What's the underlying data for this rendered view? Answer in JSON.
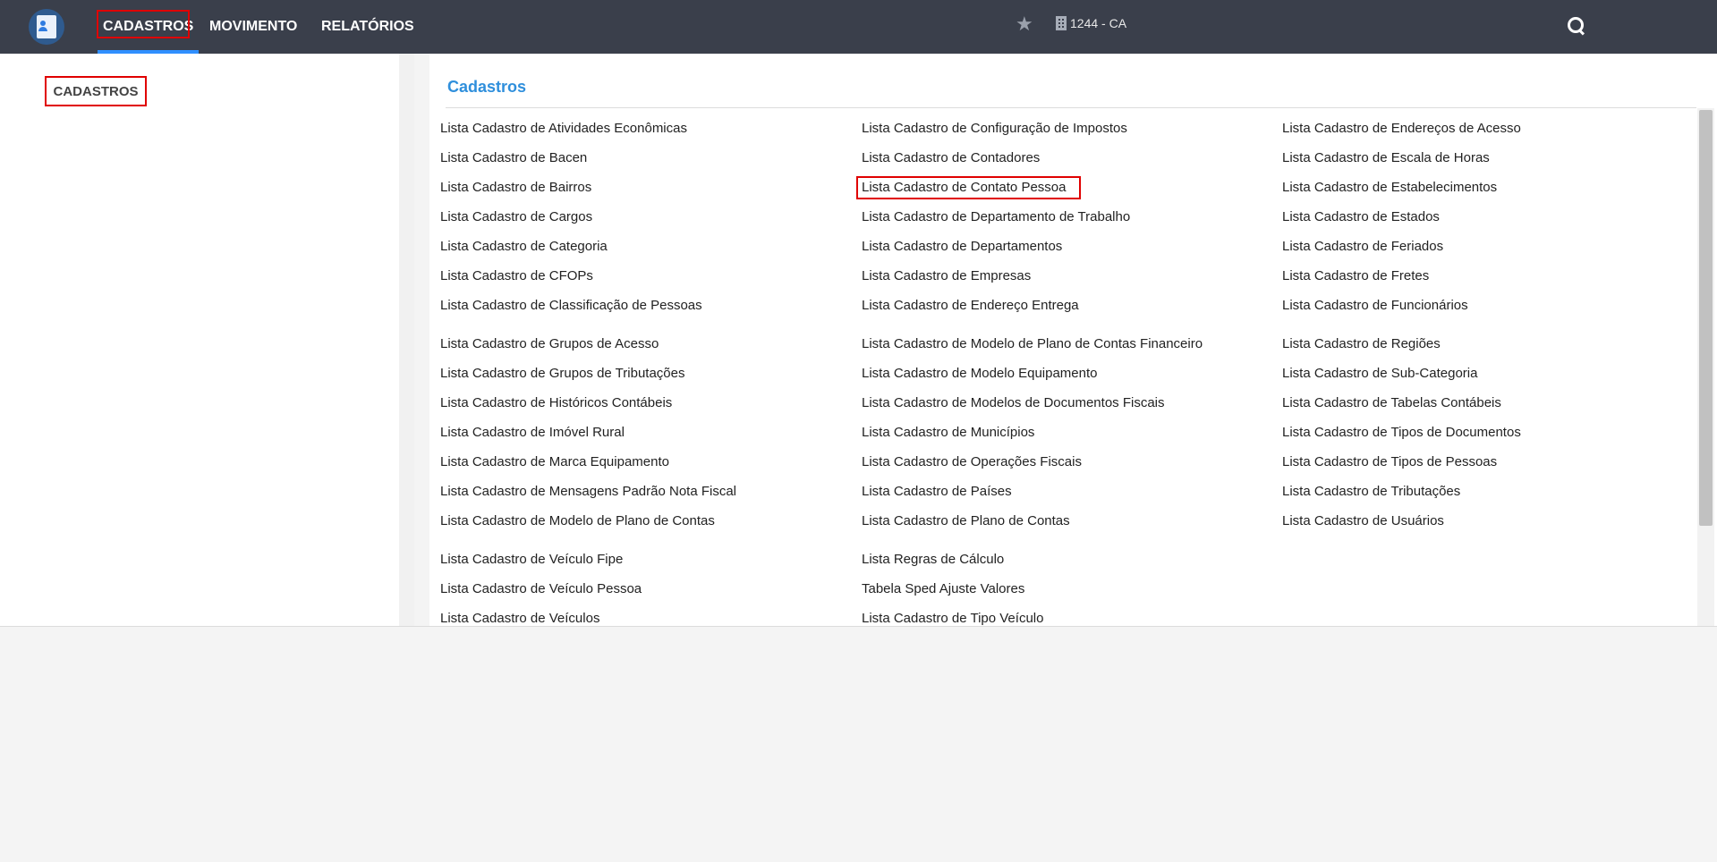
{
  "nav": {
    "items": [
      {
        "label": "CADASTROS"
      },
      {
        "label": "MOVIMENTO"
      },
      {
        "label": "RELATÓRIOS"
      }
    ],
    "company": "1244 - CA"
  },
  "sidebar": {
    "label": "CADASTROS"
  },
  "main": {
    "title": "Cadastros",
    "columns": [
      {
        "groups": [
          [
            "Lista Cadastro de Atividades Econômicas",
            "Lista Cadastro de Bacen",
            "Lista Cadastro de Bairros",
            "Lista Cadastro de Cargos",
            "Lista Cadastro de Categoria",
            "Lista Cadastro de CFOPs",
            "Lista Cadastro de Classificação de Pessoas"
          ],
          [
            "Lista Cadastro de Grupos de Acesso",
            "Lista Cadastro de Grupos de Tributações",
            "Lista Cadastro de Históricos Contábeis",
            "Lista Cadastro de Imóvel Rural",
            "Lista Cadastro de Marca Equipamento",
            "Lista Cadastro de Mensagens Padrão Nota Fiscal",
            "Lista Cadastro de Modelo de Plano de Contas"
          ],
          [
            "Lista Cadastro de Veículo Fipe",
            "Lista Cadastro de Veículo Pessoa",
            "Lista Cadastro de Veículos"
          ]
        ]
      },
      {
        "groups": [
          [
            "Lista Cadastro de Configuração de Impostos",
            "Lista Cadastro de Contadores",
            "Lista Cadastro de Contato Pessoa",
            "Lista Cadastro de Departamento de Trabalho",
            "Lista Cadastro de Departamentos",
            "Lista Cadastro de Empresas",
            "Lista Cadastro de Endereço Entrega"
          ],
          [
            "Lista Cadastro de Modelo de Plano de Contas Financeiro",
            "Lista Cadastro de Modelo Equipamento",
            "Lista Cadastro de Modelos de Documentos Fiscais",
            "Lista Cadastro de Municípios",
            "Lista Cadastro de Operações Fiscais",
            "Lista Cadastro de Países",
            "Lista Cadastro de Plano de Contas"
          ],
          [
            "Lista Regras de Cálculo",
            "Tabela Sped Ajuste Valores",
            "Lista Cadastro de Tipo Veículo"
          ]
        ]
      },
      {
        "groups": [
          [
            "Lista Cadastro de Endereços de Acesso",
            "Lista Cadastro de Escala de Horas",
            "Lista Cadastro de Estabelecimentos",
            "Lista Cadastro de Estados",
            "Lista Cadastro de Feriados",
            "Lista Cadastro de Fretes",
            "Lista Cadastro de Funcionários"
          ],
          [
            "Lista Cadastro de Regiões",
            "Lista Cadastro de Sub-Categoria",
            "Lista Cadastro de Tabelas Contábeis",
            "Lista Cadastro de Tipos de Documentos",
            "Lista Cadastro de Tipos de Pessoas",
            "Lista Cadastro de Tributações",
            "Lista Cadastro de Usuários"
          ]
        ]
      }
    ]
  },
  "colors": {
    "topbar": "#3a3f4b",
    "accent": "#2f8fff",
    "title": "#2f8fdc",
    "highlight": "#e00000"
  },
  "icons": [
    "app-logo-icon",
    "star-icon",
    "building-icon",
    "search-icon"
  ]
}
